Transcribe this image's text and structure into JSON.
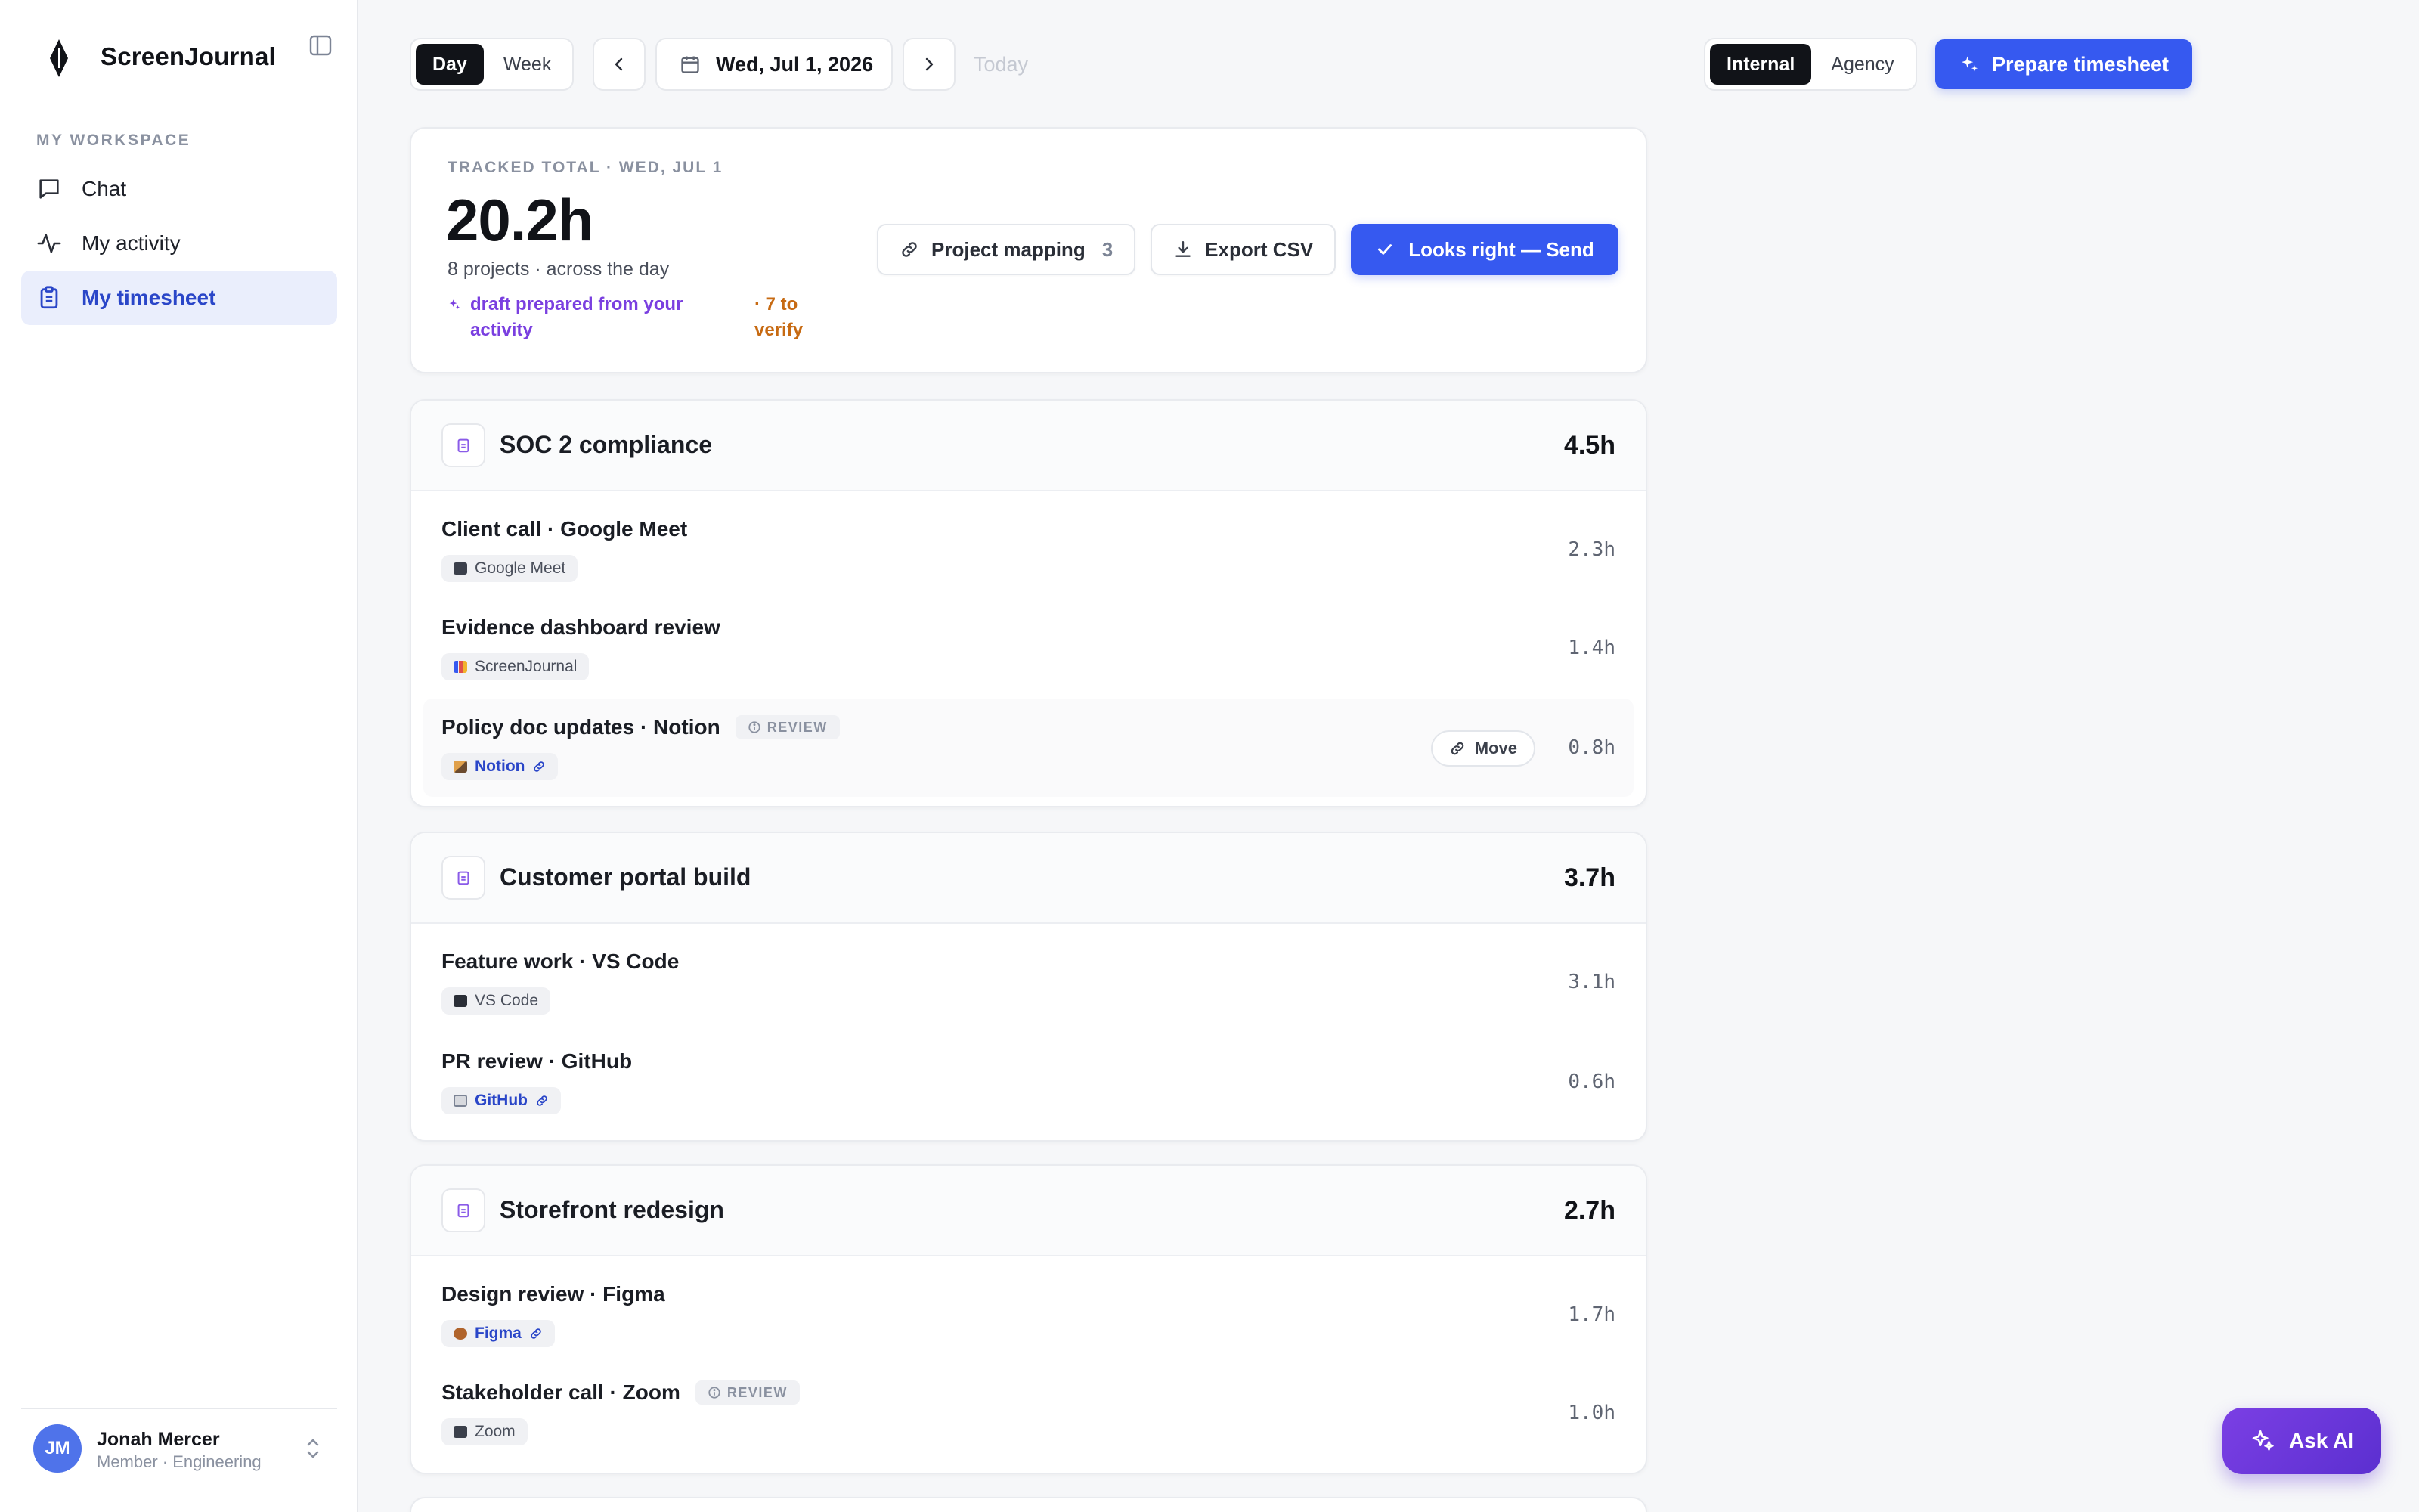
{
  "app": {
    "name": "ScreenJournal"
  },
  "sidebar": {
    "section_label": "MY WORKSPACE",
    "items": [
      {
        "label": "Chat",
        "icon": "chat-icon",
        "active": false
      },
      {
        "label": "My activity",
        "icon": "activity-icon",
        "active": false
      },
      {
        "label": "My timesheet",
        "icon": "clipboard-icon",
        "active": true
      }
    ],
    "user": {
      "initials": "JM",
      "name": "Jonah Mercer",
      "role": "Member · Engineering"
    }
  },
  "toolbar": {
    "view_options": [
      "Day",
      "Week"
    ],
    "view_selected": "Day",
    "date": "Wed, Jul 1, 2026",
    "today_label": "Today",
    "mode_options": [
      "Internal",
      "Agency"
    ],
    "mode_selected": "Internal",
    "prepare_label": "Prepare timesheet"
  },
  "summary": {
    "label": "TRACKED TOTAL · WED, JUL 1",
    "total": "20.2h",
    "subtitle": "8 projects · across the day",
    "draft_note": "draft prepared from your activity",
    "verify_note": "· 7 to verify",
    "mapping_label": "Project mapping",
    "mapping_count": "3",
    "export_label": "Export CSV",
    "send_label": "Looks right — Send"
  },
  "projects": [
    {
      "name": "SOC 2 compliance",
      "hours": "4.5h",
      "entries": [
        {
          "title": "Client call · Google Meet",
          "app": "Google Meet",
          "hours": "2.3h",
          "review": false,
          "linked": false
        },
        {
          "title": "Evidence dashboard review",
          "app": "ScreenJournal",
          "hours": "1.4h",
          "review": false,
          "linked": false
        },
        {
          "title": "Policy doc updates · Notion",
          "app": "Notion",
          "hours": "0.8h",
          "review": true,
          "linked": true,
          "review_label": "REVIEW",
          "move_label": "Move"
        }
      ]
    },
    {
      "name": "Customer portal build",
      "hours": "3.7h",
      "entries": [
        {
          "title": "Feature work · VS Code",
          "app": "VS Code",
          "hours": "3.1h",
          "review": false,
          "linked": false
        },
        {
          "title": "PR review · GitHub",
          "app": "GitHub",
          "hours": "0.6h",
          "review": false,
          "linked": true
        }
      ]
    },
    {
      "name": "Storefront redesign",
      "hours": "2.7h",
      "entries": [
        {
          "title": "Design review · Figma",
          "app": "Figma",
          "hours": "1.7h",
          "review": false,
          "linked": true
        },
        {
          "title": "Stakeholder call · Zoom",
          "app": "Zoom",
          "hours": "1.0h",
          "review": true,
          "linked": false,
          "review_label": "REVIEW"
        }
      ]
    }
  ],
  "ask_ai_label": "Ask AI",
  "colors": {
    "accent": "#3659f0",
    "draft": "#7a3fe0",
    "verify": "#c76a12",
    "ask_ai": "#6a36da"
  }
}
